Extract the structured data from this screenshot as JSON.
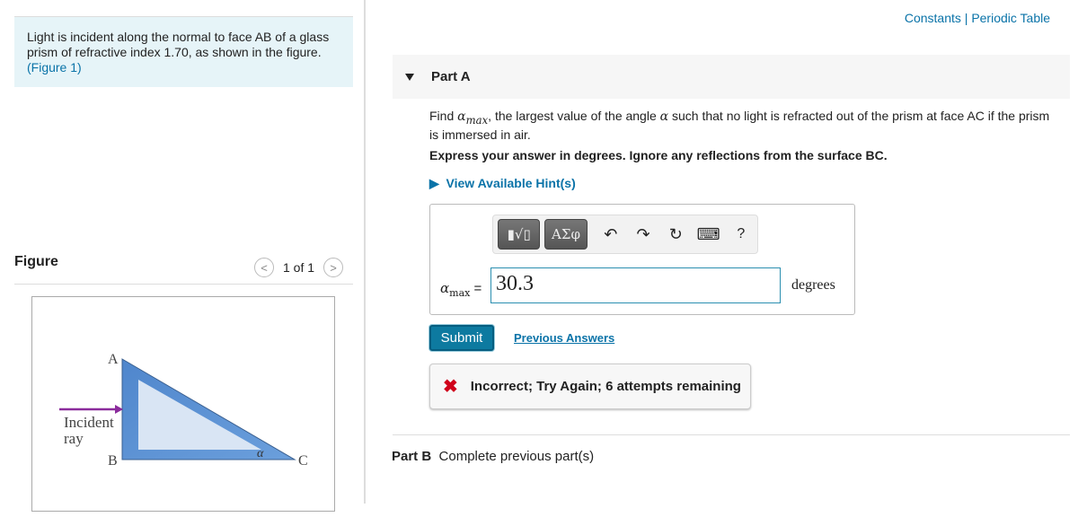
{
  "intro": {
    "text": "Light is incident along the normal to face AB of a glass prism of refractive index 1.70, as shown in the figure.",
    "figure_link": "(Figure 1)"
  },
  "figure": {
    "title": "Figure",
    "pager": "1 of 1",
    "labels": {
      "A": "A",
      "B": "B",
      "C": "C",
      "alpha": "α",
      "incident": "Incident",
      "ray": "ray"
    },
    "colors": {
      "prism": "#5b93d3",
      "ray": "#8b2c9c"
    }
  },
  "header": {
    "constants": "Constants",
    "sep": "|",
    "periodic": "Periodic Table"
  },
  "partA": {
    "title": "Part A",
    "q_pre": "Find ",
    "q_sym": "α",
    "q_sub": "max",
    "q_post": ", the largest value of the angle ",
    "q_sym2": "α",
    "q_post2": " such that no light is refracted out of the prism at face AC if the prism is immersed in air.",
    "express": "Express your answer in degrees. Ignore any reflections from the surface BC.",
    "hint": "View Available Hint(s)",
    "toolbar": {
      "templates": "▮√▯",
      "greek": "ΑΣφ",
      "undo": "↶",
      "redo": "↷",
      "reset": "↻",
      "keyboard": "⌨",
      "help": "?"
    },
    "label_sym": "α",
    "label_sub": "max",
    "label_eq": " =",
    "answer": "30.3",
    "units": "degrees",
    "submit": "Submit",
    "previous": "Previous Answers",
    "feedback_icon": "✖",
    "feedback": "Incorrect; Try Again; 6 attempts remaining"
  },
  "partB": {
    "title": "Part B",
    "text": "Complete previous part(s)"
  }
}
